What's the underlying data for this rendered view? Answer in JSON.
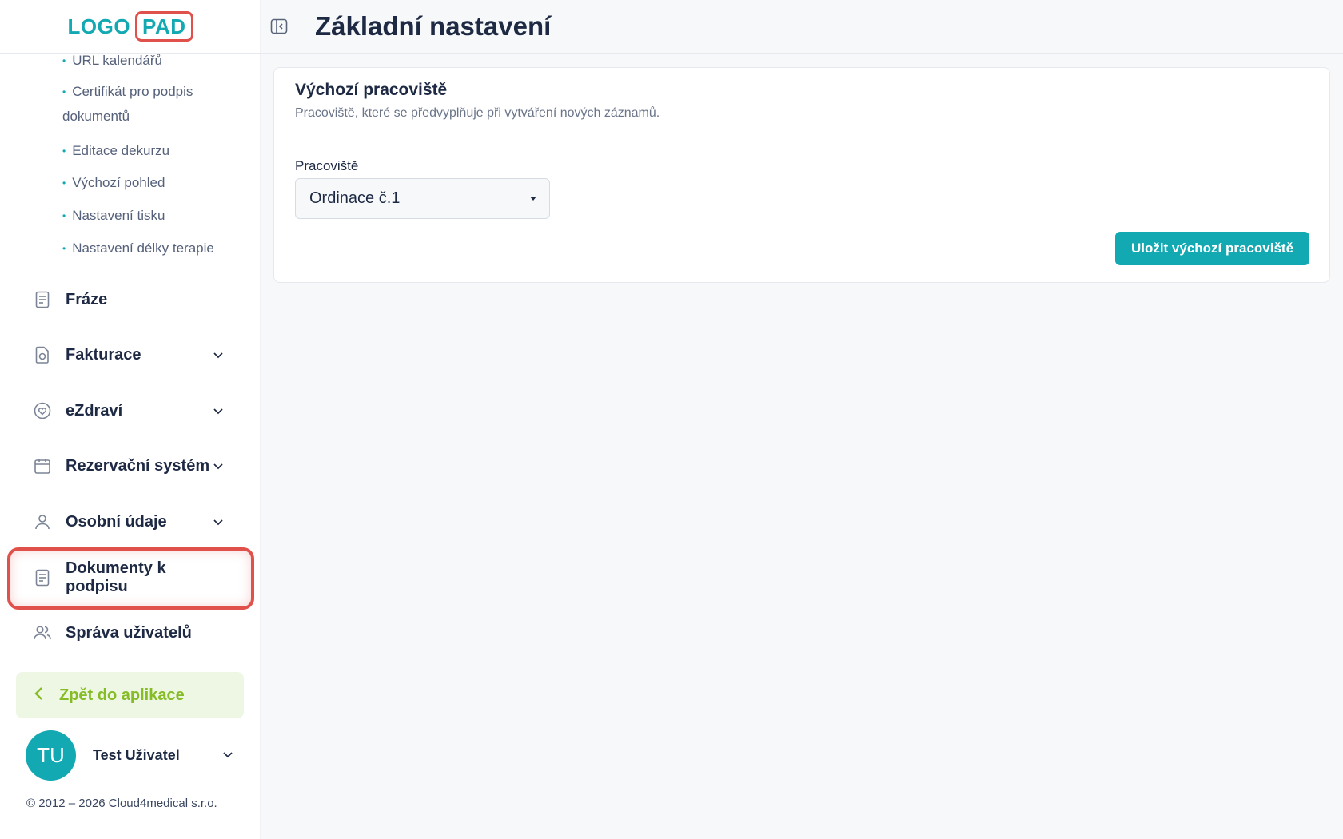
{
  "logo": {
    "part1": "LOGO",
    "part2": "PAD"
  },
  "header": {
    "title": "Základní nastavení"
  },
  "sidebar": {
    "subitems": [
      "URL kalendářů",
      "Certifikát pro podpis",
      "dokumentů",
      "Editace dekurzu",
      "Výchozí pohled",
      "Nastavení tisku",
      "Nastavení délky terapie"
    ],
    "items": [
      {
        "label": "Fráze",
        "icon": "document-icon",
        "expandable": false
      },
      {
        "label": "Fakturace",
        "icon": "invoice-icon",
        "expandable": true
      },
      {
        "label": "eZdraví",
        "icon": "heart-icon",
        "expandable": true
      },
      {
        "label": "Rezervační systém",
        "icon": "calendar-icon",
        "expandable": true
      },
      {
        "label": "Osobní údaje",
        "icon": "user-icon",
        "expandable": true
      },
      {
        "label": "Dokumenty k podpisu",
        "icon": "document-icon",
        "expandable": false
      },
      {
        "label": "Správa uživatelů",
        "icon": "users-icon",
        "expandable": false
      }
    ],
    "back_label": "Zpět do aplikace",
    "user": {
      "initials": "TU",
      "name": "Test Uživatel"
    },
    "copyright": "© 2012 – 2026 Cloud4medical s.r.o."
  },
  "card": {
    "title": "Výchozí pracoviště",
    "subtitle": "Pracoviště, které se předvyplňuje při vytváření nových záznamů.",
    "field_label": "Pracoviště",
    "select_value": "Ordinace č.1",
    "save_label": "Uložit výchozí pracoviště"
  },
  "colors": {
    "accent": "#12a9b3",
    "highlight": "#e0514b",
    "back_green": "#86bc25",
    "text": "#1e2a44"
  }
}
